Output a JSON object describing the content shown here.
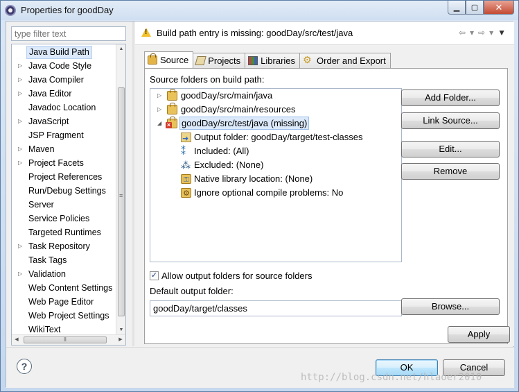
{
  "window": {
    "title": "Properties for goodDay"
  },
  "filter": {
    "placeholder": "type filter text"
  },
  "nav": {
    "items": [
      {
        "label": "Java Build Path",
        "arrow": ""
      },
      {
        "label": "Java Code Style",
        "arrow": "▷"
      },
      {
        "label": "Java Compiler",
        "arrow": "▷"
      },
      {
        "label": "Java Editor",
        "arrow": "▷"
      },
      {
        "label": "Javadoc Location",
        "arrow": ""
      },
      {
        "label": "JavaScript",
        "arrow": "▷"
      },
      {
        "label": "JSP Fragment",
        "arrow": ""
      },
      {
        "label": "Maven",
        "arrow": "▷"
      },
      {
        "label": "Project Facets",
        "arrow": "▷"
      },
      {
        "label": "Project References",
        "arrow": ""
      },
      {
        "label": "Run/Debug Settings",
        "arrow": ""
      },
      {
        "label": "Server",
        "arrow": ""
      },
      {
        "label": "Service Policies",
        "arrow": ""
      },
      {
        "label": "Targeted Runtimes",
        "arrow": ""
      },
      {
        "label": "Task Repository",
        "arrow": "▷"
      },
      {
        "label": "Task Tags",
        "arrow": ""
      },
      {
        "label": "Validation",
        "arrow": "▷"
      },
      {
        "label": "Web Content Settings",
        "arrow": ""
      },
      {
        "label": "Web Page Editor",
        "arrow": ""
      },
      {
        "label": "Web Project Settings",
        "arrow": ""
      },
      {
        "label": "WikiText",
        "arrow": ""
      }
    ]
  },
  "message": {
    "text": "Build path entry is missing: goodDay/src/test/java"
  },
  "tabs": [
    {
      "label": "Source",
      "icon": "source-folder-icon"
    },
    {
      "label": "Projects",
      "icon": "projects-icon"
    },
    {
      "label": "Libraries",
      "icon": "libraries-icon"
    },
    {
      "label": "Order and Export",
      "icon": "order-export-icon"
    }
  ],
  "source": {
    "section_label": "Source folders on build path:",
    "folders": [
      {
        "label": "goodDay/src/main/java",
        "expander": "▷"
      },
      {
        "label": "goodDay/src/main/resources",
        "expander": "▷"
      },
      {
        "label": "goodDay/src/test/java (missing)",
        "expander": "◢"
      }
    ],
    "children": [
      {
        "label": "Output folder: goodDay/target/test-classes"
      },
      {
        "label": "Included: (All)"
      },
      {
        "label": "Excluded: (None)"
      },
      {
        "label": "Native library location: (None)"
      },
      {
        "label": "Ignore optional compile problems: No"
      }
    ],
    "buttons": {
      "add_folder": "Add Folder...",
      "link_source": "Link Source...",
      "edit": "Edit...",
      "remove": "Remove",
      "browse": "Browse..."
    },
    "allow_output_label": "Allow output folders for source folders",
    "allow_output_checked": "✓",
    "default_output_label": "Default output folder:",
    "default_output_value": "goodDay/target/classes"
  },
  "actions": {
    "apply": "Apply",
    "ok": "OK",
    "cancel": "Cancel"
  },
  "watermark": "http://blog.csdn.net/hlaoer2010"
}
